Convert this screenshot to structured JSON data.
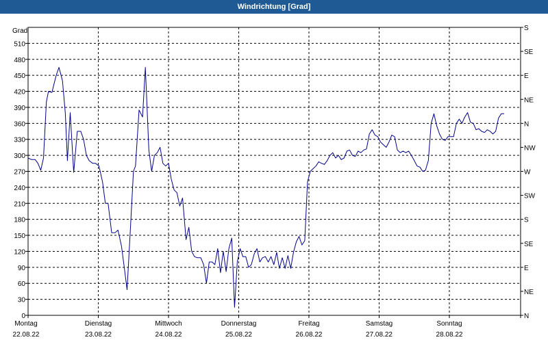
{
  "window": {
    "title": "Windrichtung [Grad]"
  },
  "colors": {
    "titlebar": "#1f5a94",
    "line": "#00008b",
    "grid": "#000000"
  },
  "chart_data": {
    "type": "line",
    "title": "Windrichtung [Grad]",
    "ylabel": "Grad",
    "ylim": [
      0,
      540
    ],
    "yticks": [
      0,
      30,
      60,
      90,
      120,
      150,
      180,
      210,
      240,
      270,
      300,
      330,
      360,
      390,
      420,
      450,
      480,
      510
    ],
    "right_axis_labels": [
      "N",
      "NE",
      "E",
      "SE",
      "S",
      "SW",
      "W",
      "NW",
      "N",
      "NE",
      "E",
      "SE",
      "S"
    ],
    "xlim_days": [
      0,
      7
    ],
    "x_labels": [
      {
        "day": "Montag",
        "date": "22.08.22"
      },
      {
        "day": "Dienstag",
        "date": "23.08.22"
      },
      {
        "day": "Mittwoch",
        "date": "24.08.22"
      },
      {
        "day": "Donnerstag",
        "date": "25.08.22"
      },
      {
        "day": "Freitag",
        "date": "26.08.22"
      },
      {
        "day": "Samstag",
        "date": "27.08.22"
      },
      {
        "day": "Sonntag",
        "date": "28.08.22"
      }
    ],
    "grid": true,
    "series": [
      {
        "values": [
          [
            0.0,
            295
          ],
          [
            0.05,
            292
          ],
          [
            0.1,
            292
          ],
          [
            0.14,
            285
          ],
          [
            0.18,
            272
          ],
          [
            0.22,
            295
          ],
          [
            0.26,
            400
          ],
          [
            0.29,
            420
          ],
          [
            0.34,
            418
          ],
          [
            0.4,
            450
          ],
          [
            0.44,
            465
          ],
          [
            0.49,
            440
          ],
          [
            0.53,
            380
          ],
          [
            0.56,
            290
          ],
          [
            0.6,
            380
          ],
          [
            0.65,
            268
          ],
          [
            0.7,
            345
          ],
          [
            0.75,
            345
          ],
          [
            0.79,
            330
          ],
          [
            0.83,
            300
          ],
          [
            0.87,
            290
          ],
          [
            0.92,
            285
          ],
          [
            0.96,
            285
          ],
          [
            1.01,
            280
          ],
          [
            1.06,
            250
          ],
          [
            1.1,
            210
          ],
          [
            1.14,
            210
          ],
          [
            1.19,
            155
          ],
          [
            1.24,
            155
          ],
          [
            1.28,
            160
          ],
          [
            1.33,
            130
          ],
          [
            1.37,
            90
          ],
          [
            1.41,
            48
          ],
          [
            1.46,
            170
          ],
          [
            1.5,
            270
          ],
          [
            1.53,
            280
          ],
          [
            1.58,
            385
          ],
          [
            1.63,
            372
          ],
          [
            1.67,
            465
          ],
          [
            1.72,
            310
          ],
          [
            1.76,
            270
          ],
          [
            1.8,
            300
          ],
          [
            1.84,
            305
          ],
          [
            1.88,
            315
          ],
          [
            1.92,
            285
          ],
          [
            1.96,
            280
          ],
          [
            2.0,
            285
          ],
          [
            2.04,
            255
          ],
          [
            2.08,
            235
          ],
          [
            2.12,
            230
          ],
          [
            2.16,
            205
          ],
          [
            2.2,
            220
          ],
          [
            2.25,
            142
          ],
          [
            2.29,
            165
          ],
          [
            2.33,
            120
          ],
          [
            2.37,
            110
          ],
          [
            2.41,
            108
          ],
          [
            2.46,
            108
          ],
          [
            2.5,
            95
          ],
          [
            2.54,
            60
          ],
          [
            2.58,
            100
          ],
          [
            2.62,
            100
          ],
          [
            2.66,
            95
          ],
          [
            2.7,
            125
          ],
          [
            2.74,
            80
          ],
          [
            2.78,
            120
          ],
          [
            2.82,
            82
          ],
          [
            2.86,
            125
          ],
          [
            2.9,
            145
          ],
          [
            2.94,
            15
          ],
          [
            2.98,
            100
          ],
          [
            3.02,
            125
          ],
          [
            3.06,
            110
          ],
          [
            3.1,
            110
          ],
          [
            3.14,
            90
          ],
          [
            3.18,
            95
          ],
          [
            3.22,
            115
          ],
          [
            3.26,
            125
          ],
          [
            3.3,
            100
          ],
          [
            3.34,
            108
          ],
          [
            3.38,
            110
          ],
          [
            3.42,
            100
          ],
          [
            3.46,
            110
          ],
          [
            3.5,
            95
          ],
          [
            3.54,
            118
          ],
          [
            3.58,
            88
          ],
          [
            3.62,
            108
          ],
          [
            3.66,
            88
          ],
          [
            3.7,
            112
          ],
          [
            3.74,
            88
          ],
          [
            3.78,
            118
          ],
          [
            3.82,
            138
          ],
          [
            3.86,
            148
          ],
          [
            3.9,
            132
          ],
          [
            3.94,
            140
          ],
          [
            3.98,
            250
          ],
          [
            4.02,
            270
          ],
          [
            4.06,
            275
          ],
          [
            4.1,
            280
          ],
          [
            4.14,
            288
          ],
          [
            4.18,
            285
          ],
          [
            4.22,
            283
          ],
          [
            4.26,
            290
          ],
          [
            4.3,
            300
          ],
          [
            4.34,
            305
          ],
          [
            4.38,
            295
          ],
          [
            4.42,
            300
          ],
          [
            4.46,
            292
          ],
          [
            4.5,
            295
          ],
          [
            4.54,
            308
          ],
          [
            4.58,
            310
          ],
          [
            4.62,
            300
          ],
          [
            4.66,
            298
          ],
          [
            4.7,
            308
          ],
          [
            4.74,
            305
          ],
          [
            4.78,
            310
          ],
          [
            4.82,
            312
          ],
          [
            4.86,
            340
          ],
          [
            4.9,
            348
          ],
          [
            4.94,
            338
          ],
          [
            4.98,
            335
          ],
          [
            5.02,
            325
          ],
          [
            5.06,
            320
          ],
          [
            5.1,
            315
          ],
          [
            5.14,
            325
          ],
          [
            5.18,
            338
          ],
          [
            5.22,
            335
          ],
          [
            5.26,
            310
          ],
          [
            5.3,
            305
          ],
          [
            5.34,
            308
          ],
          [
            5.38,
            305
          ],
          [
            5.42,
            308
          ],
          [
            5.46,
            300
          ],
          [
            5.5,
            290
          ],
          [
            5.54,
            280
          ],
          [
            5.58,
            278
          ],
          [
            5.62,
            270
          ],
          [
            5.66,
            272
          ],
          [
            5.7,
            290
          ],
          [
            5.74,
            360
          ],
          [
            5.78,
            378
          ],
          [
            5.82,
            355
          ],
          [
            5.86,
            340
          ],
          [
            5.9,
            330
          ],
          [
            5.94,
            328
          ],
          [
            5.98,
            335
          ],
          [
            6.02,
            335
          ],
          [
            6.06,
            335
          ],
          [
            6.1,
            360
          ],
          [
            6.14,
            368
          ],
          [
            6.18,
            360
          ],
          [
            6.22,
            372
          ],
          [
            6.26,
            380
          ],
          [
            6.3,
            362
          ],
          [
            6.34,
            360
          ],
          [
            6.38,
            348
          ],
          [
            6.42,
            350
          ],
          [
            6.46,
            345
          ],
          [
            6.5,
            343
          ],
          [
            6.54,
            348
          ],
          [
            6.58,
            345
          ],
          [
            6.62,
            340
          ],
          [
            6.66,
            345
          ],
          [
            6.7,
            370
          ],
          [
            6.74,
            378
          ],
          [
            6.78,
            378
          ]
        ]
      }
    ]
  }
}
